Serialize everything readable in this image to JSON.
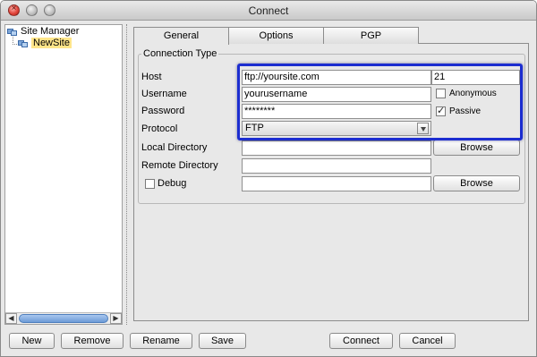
{
  "window": {
    "title": "Connect"
  },
  "tree": {
    "root": "Site Manager",
    "site": "NewSite"
  },
  "tabs": [
    {
      "label": "General"
    },
    {
      "label": "Options"
    },
    {
      "label": "PGP"
    }
  ],
  "form": {
    "group_label": "Connection Type",
    "host_label": "Host",
    "host_value": "ftp://yoursite.com",
    "port_value": "21",
    "username_label": "Username",
    "username_value": "yourusername",
    "anonymous_label": "Anonymous",
    "anonymous_checked": false,
    "password_label": "Password",
    "password_value": "********",
    "passive_label": "Passive",
    "passive_checked": true,
    "protocol_label": "Protocol",
    "protocol_value": "FTP",
    "local_dir_label": "Local Directory",
    "local_dir_value": "",
    "remote_dir_label": "Remote Directory",
    "remote_dir_value": "",
    "debug_label": "Debug",
    "debug_checked": false,
    "debug_value": "",
    "browse_label": "Browse"
  },
  "buttons": {
    "new": "New",
    "remove": "Remove",
    "rename": "Rename",
    "save": "Save",
    "connect": "Connect",
    "cancel": "Cancel"
  },
  "colors": {
    "highlight": "#1c2dd0",
    "selected_bg": "#ffe58a"
  }
}
